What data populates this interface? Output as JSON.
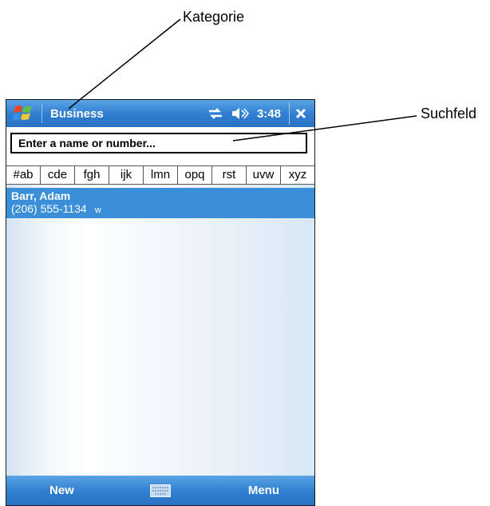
{
  "annotations": {
    "category_label": "Kategorie",
    "search_label": "Suchfeld"
  },
  "titlebar": {
    "title": "Business",
    "time": "3:48",
    "icons": [
      "windows-start-icon",
      "connectivity-icon",
      "speaker-icon",
      "close-icon"
    ]
  },
  "search": {
    "placeholder": "Enter a name or number..."
  },
  "alphabet_tabs": [
    "#ab",
    "cde",
    "fgh",
    "ijk",
    "lmn",
    "opq",
    "rst",
    "uvw",
    "xyz"
  ],
  "contacts": [
    {
      "name": "Barr, Adam",
      "phone": "(206) 555-1134",
      "phone_type": "w"
    }
  ],
  "softbar": {
    "left": "New",
    "right": "Menu",
    "center_icon": "keyboard-icon"
  },
  "colors": {
    "titlebar_blue": "#2f7ed0",
    "selection_blue": "#3b8ed8"
  }
}
